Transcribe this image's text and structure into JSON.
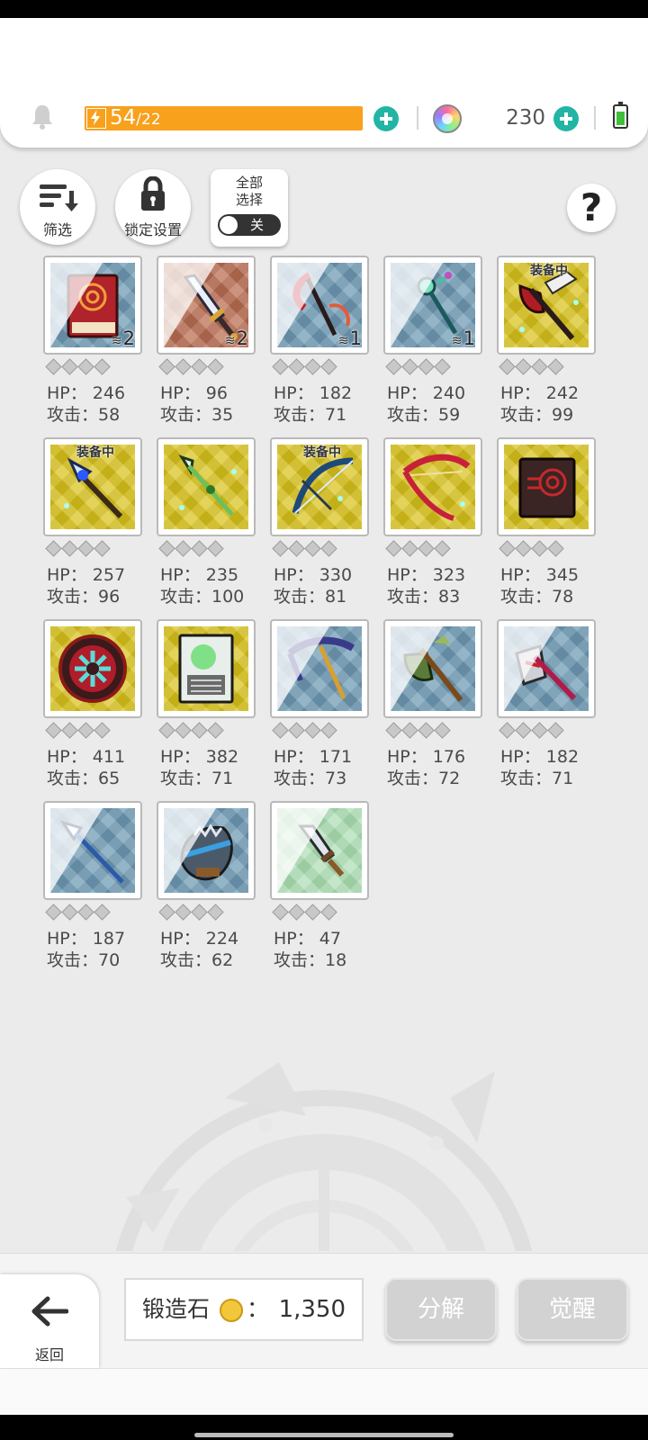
{
  "header": {
    "energy_current": "54",
    "energy_max": "/22",
    "gem_count": "230"
  },
  "controls": {
    "filter_label": "筛选",
    "lock_label": "锁定设置",
    "select_all_label": "全部\n选择",
    "select_all_state": "关"
  },
  "items": [
    {
      "bg": "blue",
      "icon": "red-book-icon",
      "hp": "HP： 246",
      "atk": "攻击：58",
      "qty": "2",
      "equipped": ""
    },
    {
      "bg": "bronze",
      "icon": "sword-icon",
      "hp": "HP： 96",
      "atk": "攻击：35",
      "qty": "2",
      "equipped": ""
    },
    {
      "bg": "blue",
      "icon": "scythe-icon",
      "hp": "HP： 182",
      "atk": "攻击：71",
      "qty": "1",
      "equipped": ""
    },
    {
      "bg": "blue",
      "icon": "staff-icon",
      "hp": "HP： 240",
      "atk": "攻击：59",
      "qty": "1",
      "equipped": ""
    },
    {
      "bg": "gold",
      "icon": "battle-axe-icon",
      "hp": "HP： 242",
      "atk": "攻击：99",
      "qty": "",
      "equipped": "装备中"
    },
    {
      "bg": "gold",
      "icon": "halberd-icon",
      "hp": "HP： 257",
      "atk": "攻击：96",
      "qty": "",
      "equipped": "装备中"
    },
    {
      "bg": "gold",
      "icon": "spear-icon",
      "hp": "HP： 235",
      "atk": "攻击：100",
      "qty": "",
      "equipped": ""
    },
    {
      "bg": "gold",
      "icon": "blue-bow-icon",
      "hp": "HP： 330",
      "atk": "攻击：81",
      "qty": "",
      "equipped": "装备中"
    },
    {
      "bg": "gold",
      "icon": "red-bow-icon",
      "hp": "HP： 323",
      "atk": "攻击：83",
      "qty": "",
      "equipped": ""
    },
    {
      "bg": "gold",
      "icon": "dark-book-icon",
      "hp": "HP： 345",
      "atk": "攻击：78",
      "qty": "",
      "equipped": ""
    },
    {
      "bg": "gold",
      "icon": "orb-icon",
      "hp": "HP： 411",
      "atk": "攻击：65",
      "qty": "",
      "equipped": ""
    },
    {
      "bg": "gold",
      "icon": "tome-icon",
      "hp": "HP： 382",
      "atk": "攻击：71",
      "qty": "",
      "equipped": ""
    },
    {
      "bg": "blue",
      "icon": "pickaxe-icon",
      "hp": "HP： 171",
      "atk": "攻击：73",
      "qty": "",
      "equipped": ""
    },
    {
      "bg": "blue",
      "icon": "green-axe-icon",
      "hp": "HP： 176",
      "atk": "攻击：72",
      "qty": "",
      "equipped": ""
    },
    {
      "bg": "blue",
      "icon": "red-axe-icon",
      "hp": "HP： 182",
      "atk": "攻击：71",
      "qty": "",
      "equipped": ""
    },
    {
      "bg": "blue",
      "icon": "lance-icon",
      "hp": "HP： 187",
      "atk": "攻击：70",
      "qty": "",
      "equipped": ""
    },
    {
      "bg": "blue",
      "icon": "gauntlet-icon",
      "hp": "HP： 224",
      "atk": "攻击：62",
      "qty": "",
      "equipped": ""
    },
    {
      "bg": "green",
      "icon": "dagger-icon",
      "hp": "HP： 47",
      "atk": "攻击：18",
      "qty": "",
      "equipped": ""
    }
  ],
  "footer": {
    "back_label": "返回",
    "forge_label": "锻造石",
    "forge_colon": "：",
    "forge_value": "1,350",
    "decompose_label": "分解",
    "awaken_label": "觉醒"
  },
  "colors": {
    "energy": "#f7a11c",
    "accent": "#22b5a4",
    "rarity_blue": "#6f9bb5",
    "rarity_gold": "#d8c21a",
    "rarity_bronze": "#b96d52",
    "rarity_green": "#a9dcb0"
  }
}
